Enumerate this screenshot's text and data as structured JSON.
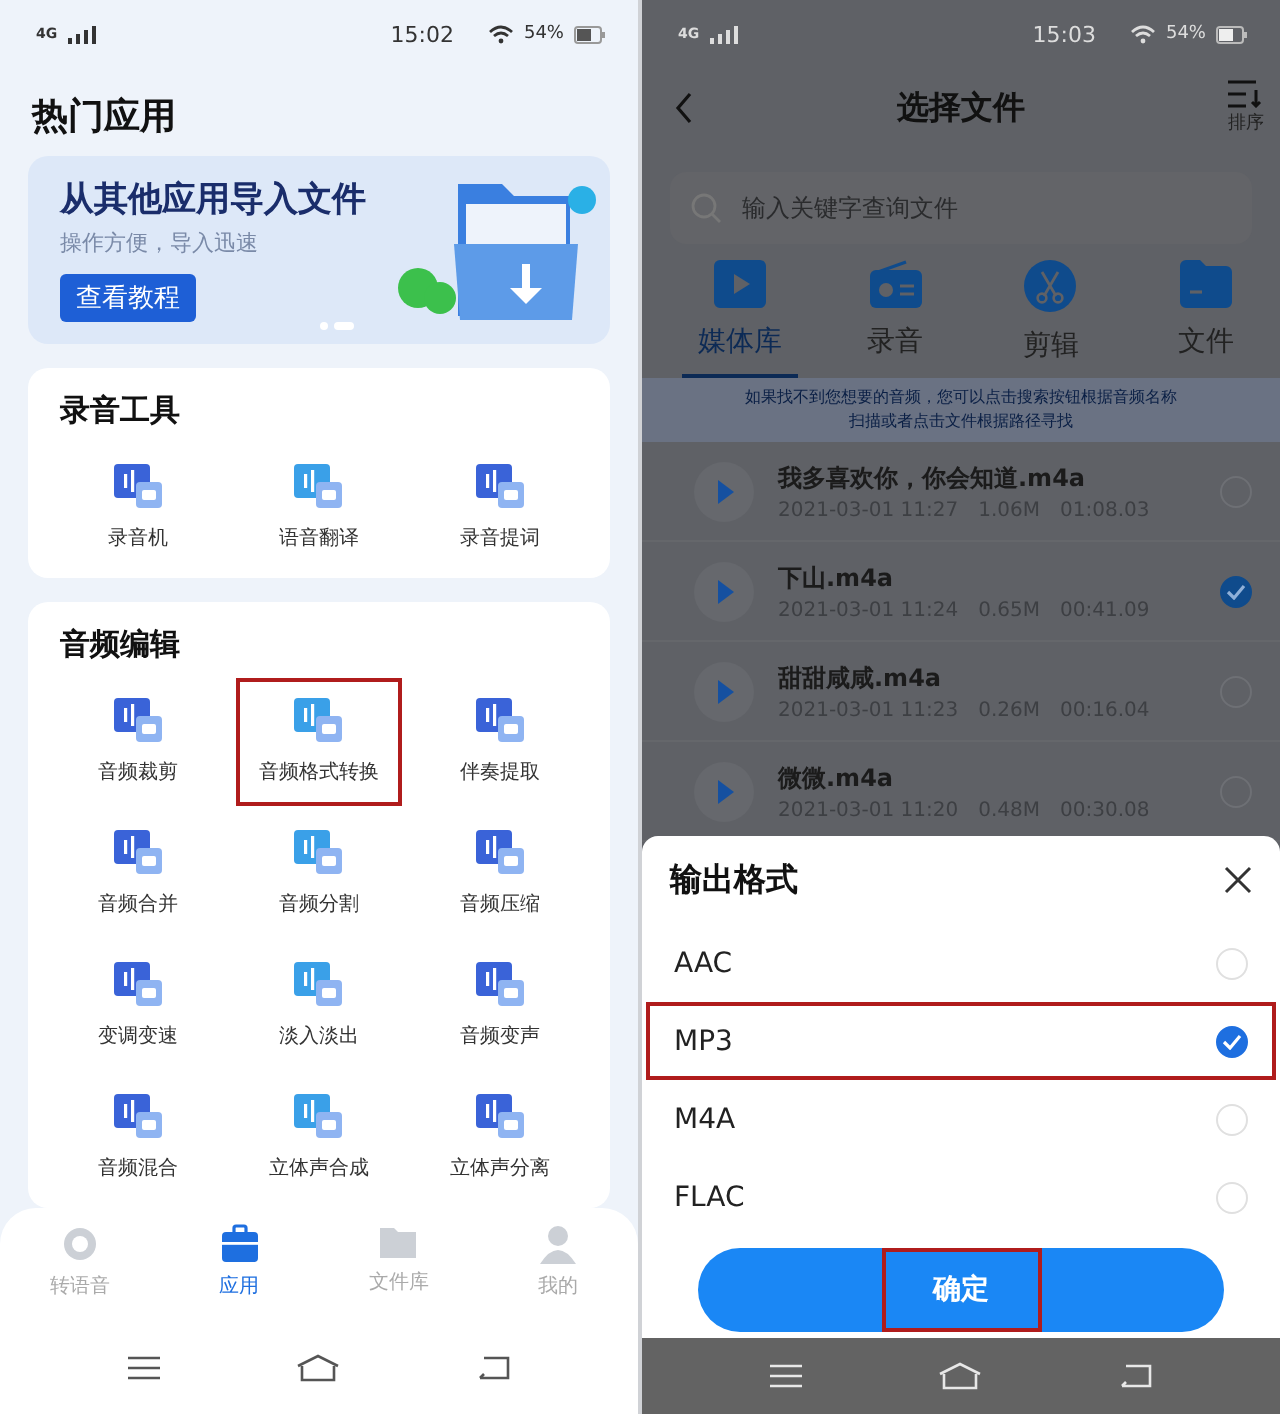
{
  "left": {
    "status": {
      "network": "4G",
      "time": "15:02",
      "battery": "54%"
    },
    "heading": "热门应用",
    "banner": {
      "title": "从其他应用导入文件",
      "subtitle": "操作方便，导入迅速",
      "button": "查看教程"
    },
    "sections": [
      {
        "title": "录音工具",
        "tools": [
          {
            "label": "录音机",
            "highlighted": false
          },
          {
            "label": "语音翻译",
            "highlighted": false
          },
          {
            "label": "录音提词",
            "highlighted": false
          }
        ]
      },
      {
        "title": "音频编辑",
        "tools": [
          {
            "label": "音频裁剪",
            "highlighted": false
          },
          {
            "label": "音频格式转换",
            "highlighted": true
          },
          {
            "label": "伴奏提取",
            "highlighted": false
          },
          {
            "label": "音频合并",
            "highlighted": false
          },
          {
            "label": "音频分割",
            "highlighted": false
          },
          {
            "label": "音频压缩",
            "highlighted": false
          },
          {
            "label": "变调变速",
            "highlighted": false
          },
          {
            "label": "淡入淡出",
            "highlighted": false
          },
          {
            "label": "音频变声",
            "highlighted": false
          },
          {
            "label": "音频混合",
            "highlighted": false
          },
          {
            "label": "立体声合成",
            "highlighted": false
          },
          {
            "label": "立体声分离",
            "highlighted": false
          }
        ]
      }
    ],
    "nav": [
      {
        "label": "转语音",
        "kind": "voice",
        "selected": false
      },
      {
        "label": "应用",
        "kind": "apps",
        "selected": true
      },
      {
        "label": "文件库",
        "kind": "files",
        "selected": false
      },
      {
        "label": "我的",
        "kind": "me",
        "selected": false
      }
    ]
  },
  "right": {
    "status": {
      "network": "4G",
      "time": "15:03",
      "battery": "54%"
    },
    "title": "选择文件",
    "sort": "排序",
    "search": {
      "placeholder": "输入关键字查询文件"
    },
    "tabs": [
      {
        "label": "媒体库",
        "kind": "media",
        "selected": true
      },
      {
        "label": "录音",
        "kind": "radio",
        "selected": false
      },
      {
        "label": "剪辑",
        "kind": "cut",
        "selected": false
      },
      {
        "label": "文件",
        "kind": "folder",
        "selected": false
      }
    ],
    "hint": [
      "如果找不到您想要的音频，您可以点击搜索按钮根据音频名称",
      "扫描或者点击文件根据路径寻找"
    ],
    "files": [
      {
        "name": "我多喜欢你，你会知道.m4a",
        "date": "2021-03-01 11:27",
        "size": "1.06M",
        "duration": "01:08.03",
        "selected": false
      },
      {
        "name": "下山.m4a",
        "date": "2021-03-01 11:24",
        "size": "0.65M",
        "duration": "00:41.09",
        "selected": true
      },
      {
        "name": "甜甜咸咸.m4a",
        "date": "2021-03-01 11:23",
        "size": "0.26M",
        "duration": "00:16.04",
        "selected": false
      },
      {
        "name": "微微.m4a",
        "date": "2021-03-01 11:20",
        "size": "0.48M",
        "duration": "00:30.08",
        "selected": false
      }
    ],
    "sheet": {
      "title": "输出格式",
      "options": [
        {
          "label": "AAC",
          "selected": false,
          "highlighted": false
        },
        {
          "label": "MP3",
          "selected": true,
          "highlighted": true
        },
        {
          "label": "M4A",
          "selected": false,
          "highlighted": false
        },
        {
          "label": "FLAC",
          "selected": false,
          "highlighted": false
        }
      ],
      "button": {
        "label": "确定",
        "highlighted": true
      }
    }
  }
}
